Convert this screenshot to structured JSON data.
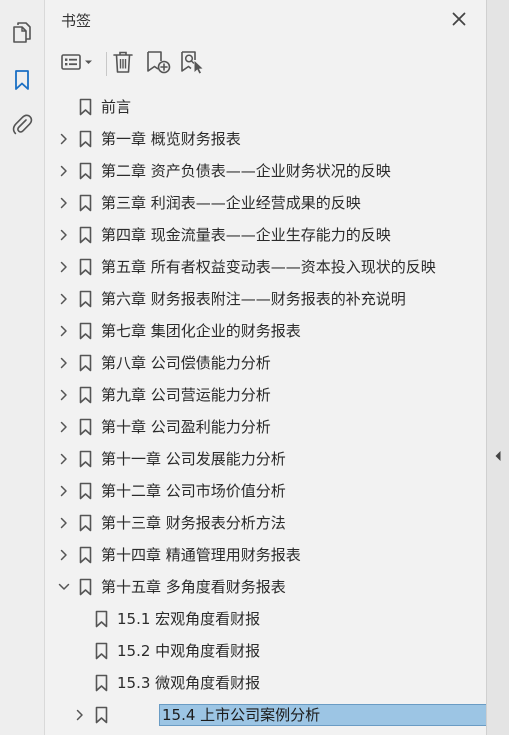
{
  "rail": {
    "pages_icon": "pages-icon",
    "bookmarks_icon": "bookmark-icon",
    "attachments_icon": "paperclip-icon"
  },
  "panel": {
    "title": "书签",
    "close_icon": "close-icon"
  },
  "toolbar": {
    "options_icon": "options-list-icon",
    "delete_icon": "trash-icon",
    "new_bookmark_icon": "add-bookmark-icon",
    "find_bookmark_icon": "find-bookmark-icon"
  },
  "bookmarks": [
    {
      "label": "前言",
      "level": 0,
      "expander": "none",
      "selected": false
    },
    {
      "label": "第一章 概览财务报表",
      "level": 0,
      "expander": "collapsed",
      "selected": false
    },
    {
      "label": "第二章 资产负债表——企业财务状况的反映",
      "level": 0,
      "expander": "collapsed",
      "selected": false
    },
    {
      "label": "第三章 利润表——企业经营成果的反映",
      "level": 0,
      "expander": "collapsed",
      "selected": false
    },
    {
      "label": "第四章 现金流量表——企业生存能力的反映",
      "level": 0,
      "expander": "collapsed",
      "selected": false
    },
    {
      "label": "第五章 所有者权益变动表——资本投入现状的反映",
      "level": 0,
      "expander": "collapsed",
      "selected": false
    },
    {
      "label": "第六章 财务报表附注——财务报表的补充说明",
      "level": 0,
      "expander": "collapsed",
      "selected": false
    },
    {
      "label": "第七章 集团化企业的财务报表",
      "level": 0,
      "expander": "collapsed",
      "selected": false
    },
    {
      "label": "第八章 公司偿债能力分析",
      "level": 0,
      "expander": "collapsed",
      "selected": false
    },
    {
      "label": "第九章 公司营运能力分析",
      "level": 0,
      "expander": "collapsed",
      "selected": false
    },
    {
      "label": "第十章 公司盈利能力分析",
      "level": 0,
      "expander": "collapsed",
      "selected": false
    },
    {
      "label": "第十一章 公司发展能力分析",
      "level": 0,
      "expander": "collapsed",
      "selected": false
    },
    {
      "label": "第十二章 公司市场价值分析",
      "level": 0,
      "expander": "collapsed",
      "selected": false
    },
    {
      "label": "第十三章 财务报表分析方法",
      "level": 0,
      "expander": "collapsed",
      "selected": false
    },
    {
      "label": "第十四章 精通管理用财务报表",
      "level": 0,
      "expander": "collapsed",
      "selected": false
    },
    {
      "label": "第十五章 多角度看财务报表",
      "level": 0,
      "expander": "expanded",
      "selected": false
    },
    {
      "label": "15.1 宏观角度看财报",
      "level": 1,
      "expander": "none",
      "selected": false
    },
    {
      "label": "15.2 中观角度看财报",
      "level": 1,
      "expander": "none",
      "selected": false
    },
    {
      "label": "15.3 微观角度看财报",
      "level": 1,
      "expander": "none",
      "selected": false
    },
    {
      "label": "15.4 上市公司案例分析",
      "level": 1,
      "expander": "collapsed",
      "selected": true
    }
  ],
  "colors": {
    "accent": "#1a6fc4",
    "selection": "#9cc5e4",
    "icon": "#555555"
  },
  "side_strip": {
    "collapse_icon": "collapse-left-icon"
  }
}
